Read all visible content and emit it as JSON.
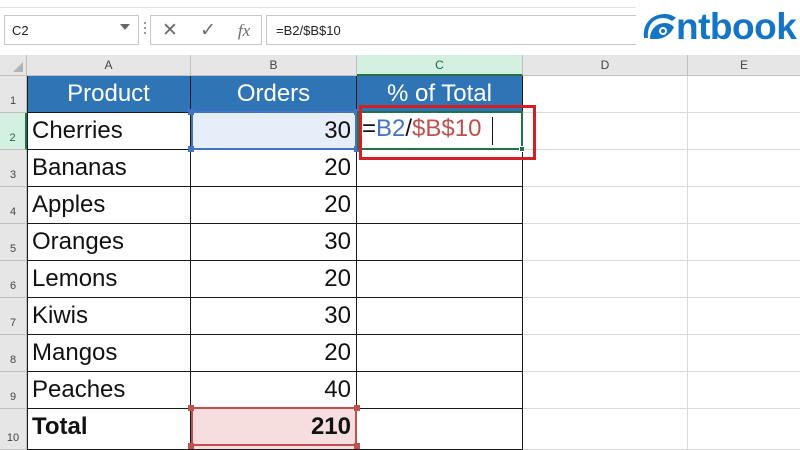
{
  "formula_bar": {
    "name_box": "C2",
    "cancel_icon": "✕",
    "enter_icon": "✓",
    "fx_label": "fx",
    "formula": "=B2/$B$10"
  },
  "logo": {
    "text": "ntbook"
  },
  "columns": [
    "A",
    "B",
    "C",
    "D",
    "E"
  ],
  "rows": [
    "1",
    "2",
    "3",
    "4",
    "5",
    "6",
    "7",
    "8",
    "9",
    "10"
  ],
  "table": {
    "headers": {
      "product": "Product",
      "orders": "Orders",
      "percent": "% of Total"
    },
    "items": [
      {
        "product": "Cherries",
        "orders": "30"
      },
      {
        "product": "Bananas",
        "orders": "20"
      },
      {
        "product": "Apples",
        "orders": "20"
      },
      {
        "product": "Oranges",
        "orders": "30"
      },
      {
        "product": "Lemons",
        "orders": "20"
      },
      {
        "product": "Kiwis",
        "orders": "30"
      },
      {
        "product": "Mangos",
        "orders": "20"
      },
      {
        "product": "Peaches",
        "orders": "40"
      }
    ],
    "total": {
      "label": "Total",
      "orders": "210"
    }
  },
  "editing_cell": {
    "eq": "=",
    "ref1": "B2",
    "slash": "/",
    "ref2": "$B$10"
  },
  "colors": {
    "header_fill": "#2f75b5",
    "ref1_color": "#4472c4",
    "ref2_color": "#c0504d",
    "highlight": "#d32027",
    "active_green": "#217346",
    "logo_blue": "#1475c6"
  }
}
